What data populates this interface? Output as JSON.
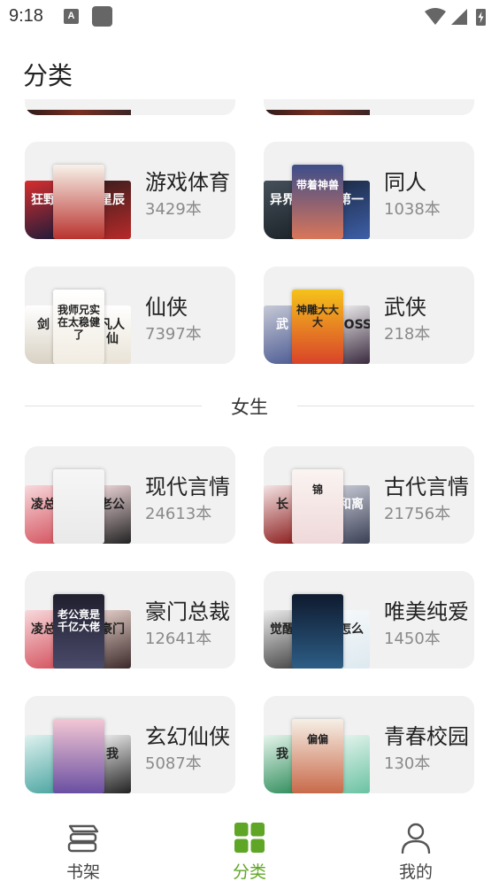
{
  "status_bar": {
    "time": "9:18",
    "notif_letter": "A"
  },
  "header": {
    "title": "分类"
  },
  "male_categories": [
    {
      "name": "游戏体育",
      "count": "3429本",
      "covers": [
        {
          "bg": "linear-gradient(160deg,#d62e2e,#1d1b3a)",
          "text": "狂野"
        },
        {
          "bg": "linear-gradient(180deg,#f7f2ea,#b9332e)",
          "text": ""
        },
        {
          "bg": "linear-gradient(160deg,#3a1d1d,#b82a2a)",
          "text": "星辰"
        }
      ]
    },
    {
      "name": "同人",
      "count": "1038本",
      "covers": [
        {
          "bg": "linear-gradient(160deg,#44505a,#1c2228)",
          "text": "异界"
        },
        {
          "bg": "linear-gradient(180deg,#3d4d8a,#d9765a)",
          "text": "带着神兽"
        },
        {
          "bg": "linear-gradient(160deg,#1c2a44,#3e5fa8)",
          "text": "第一"
        }
      ]
    },
    {
      "name": "仙侠",
      "count": "7397本",
      "covers": [
        {
          "bg": "linear-gradient(180deg,#ffffff,#d9d2c4)",
          "text": "剑"
        },
        {
          "bg": "linear-gradient(180deg,#ffffff,#f1ece2)",
          "text": "我师兄实在太稳健了"
        },
        {
          "bg": "linear-gradient(180deg,#ffffff,#e9e3d6)",
          "text": "凡人仙"
        }
      ]
    },
    {
      "name": "武侠",
      "count": "218本",
      "covers": [
        {
          "bg": "linear-gradient(160deg,#c6c9d6,#4b5a92)",
          "text": "武"
        },
        {
          "bg": "linear-gradient(180deg,#f5c21a,#d9432a)",
          "text": "神雕大大大"
        },
        {
          "bg": "linear-gradient(160deg,#f2f2f2,#3a2a3e)",
          "text": "BOSS"
        }
      ]
    }
  ],
  "divider": {
    "label": "女生"
  },
  "female_categories": [
    {
      "name": "现代言情",
      "count": "24613本",
      "covers": [
        {
          "bg": "linear-gradient(160deg,#f7d9dc,#d4525e)",
          "text": "凌总"
        },
        {
          "bg": "linear-gradient(180deg,#f6f6f6,#e9e9e9)",
          "text": ""
        },
        {
          "bg": "linear-gradient(160deg,#f1d9dc,#222)",
          "text": "老公"
        }
      ]
    },
    {
      "name": "古代言情",
      "count": "21756本",
      "covers": [
        {
          "bg": "linear-gradient(160deg,#f4e4e4,#8a1a1a)",
          "text": "长"
        },
        {
          "bg": "linear-gradient(180deg,#faf4f1,#efd8da)",
          "text": "锦"
        },
        {
          "bg": "linear-gradient(160deg,#c9ccd6,#3a3f55)",
          "text": "和离"
        }
      ]
    },
    {
      "name": "豪门总裁",
      "count": "12641本",
      "covers": [
        {
          "bg": "linear-gradient(160deg,#f7d9dc,#d4525e)",
          "text": "凌总"
        },
        {
          "bg": "linear-gradient(180deg,#1f1f2e,#4a4a6a)",
          "text": "老公竟是千亿大佬"
        },
        {
          "bg": "linear-gradient(160deg,#e8d2cc,#3b2a2a)",
          "text": "豪门"
        }
      ]
    },
    {
      "name": "唯美纯爱",
      "count": "1450本",
      "covers": [
        {
          "bg": "linear-gradient(160deg,#ececec,#444)",
          "text": "觉醒"
        },
        {
          "bg": "linear-gradient(180deg,#0e1a2e,#2d5d86)",
          "text": ""
        },
        {
          "bg": "linear-gradient(160deg,#f6f9fb,#dde9ef)",
          "text": "怎么"
        }
      ]
    },
    {
      "name": "玄幻仙侠",
      "count": "5087本",
      "covers": [
        {
          "bg": "linear-gradient(160deg,#dff2f0,#4aa4a0)",
          "text": ""
        },
        {
          "bg": "linear-gradient(180deg,#f3c7d4,#6a4fa2)",
          "text": ""
        },
        {
          "bg": "linear-gradient(160deg,#f2f2f2,#222)",
          "text": "我"
        }
      ]
    },
    {
      "name": "青春校园",
      "count": "130本",
      "covers": [
        {
          "bg": "linear-gradient(160deg,#e6f5ec,#2e8c5a)",
          "text": "我"
        },
        {
          "bg": "linear-gradient(180deg,#f6efe6,#c86a4a)",
          "text": "偏偏"
        },
        {
          "bg": "linear-gradient(160deg,#e9f6f1,#6ac2a2)",
          "text": ""
        }
      ]
    }
  ],
  "tabs": [
    {
      "label": "书架",
      "icon": "bookshelf-icon"
    },
    {
      "label": "分类",
      "icon": "category-grid-icon"
    },
    {
      "label": "我的",
      "icon": "profile-icon"
    }
  ],
  "colors": {
    "accent": "#5fa626",
    "card_bg": "#f1f1f1",
    "muted": "#8a8a8a"
  }
}
